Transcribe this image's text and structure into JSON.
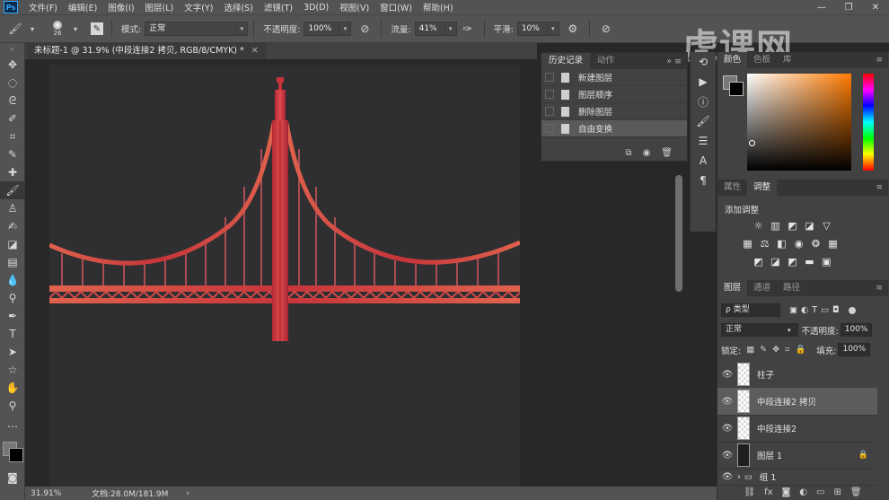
{
  "menubar": {
    "logo": "Ps",
    "items": [
      "文件(F)",
      "编辑(E)",
      "图像(I)",
      "图层(L)",
      "文字(Y)",
      "选择(S)",
      "滤镜(T)",
      "3D(D)",
      "视图(V)",
      "窗口(W)",
      "帮助(H)"
    ]
  },
  "options": {
    "brush_size": "26",
    "mode_label": "模式:",
    "mode_value": "正常",
    "opacity_label": "不透明度:",
    "opacity_value": "100%",
    "flow_label": "流量:",
    "flow_value": "41%",
    "smooth_label": "平滑:",
    "smooth_value": "10%"
  },
  "document": {
    "tab_title": "未标题-1 @ 31.9% (中段连接2 拷贝, RGB/8/CMYK) *"
  },
  "status": {
    "zoom": "31.91%",
    "doc_info": "文档:28.0M/181.9M"
  },
  "history_panel": {
    "tabs": [
      "历史记录",
      "动作"
    ],
    "items": [
      "新建图层",
      "图层顺序",
      "删除图层",
      "自由变换"
    ]
  },
  "color_panel": {
    "tabs": [
      "颜色",
      "色板",
      "库"
    ]
  },
  "adjustments_panel": {
    "tabs": [
      "属性",
      "调整"
    ],
    "title": "添加调整"
  },
  "layers_panel": {
    "tabs": [
      "图层",
      "通道",
      "路径"
    ],
    "filter_value": "ρ 类型",
    "blend_mode": "正常",
    "opacity_label": "不透明度:",
    "opacity_value": "100%",
    "lock_label": "锁定:",
    "fill_label": "填充:",
    "fill_value": "100%",
    "layers": [
      {
        "name": "柱子"
      },
      {
        "name": "中段连接2 拷贝"
      },
      {
        "name": "中段连接2"
      },
      {
        "name": "图层 1"
      },
      {
        "name": "组 1"
      }
    ]
  },
  "watermark": "虎课网",
  "colors": {
    "bridge_red": "#d0413f",
    "canvas_bg": "#2f2f31"
  }
}
